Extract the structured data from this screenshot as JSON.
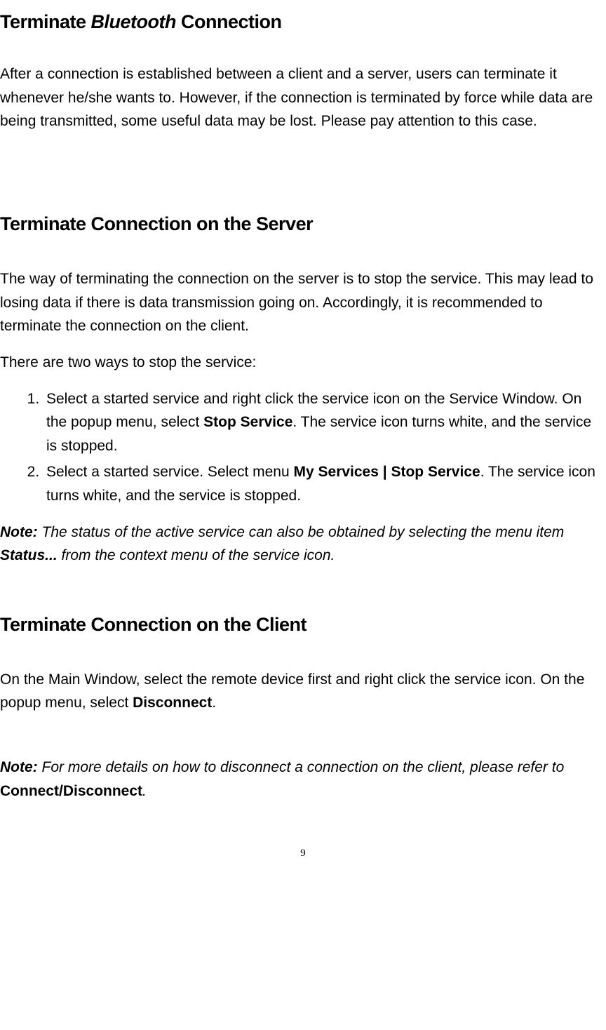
{
  "heading1": {
    "pre": "Terminate ",
    "em": "Bluetooth",
    "post": " Connection"
  },
  "para1": "After a connection is established between a client and a server, users can terminate it whenever he/she wants to. However, if the connection is terminated by force while data are being transmitted, some useful data may be lost. Please pay attention to this case.",
  "heading2": "Terminate Connection on the Server",
  "para2": "The way of terminating the connection on the server is to stop the service. This may lead to losing data if there is data transmission going on. Accordingly, it is recommended to terminate the connection on the client.",
  "para3": "There are two ways to stop the service:",
  "list": {
    "item1": {
      "t1": "Select a started service and right click the service icon on the Service Window.   On the popup menu, select ",
      "b1": "Stop Service",
      "t2": ". The service icon turns white, and the service is stopped."
    },
    "item2": {
      "t1": "Select a started service. Select menu ",
      "b1": "My Services | Stop Service",
      "t2": ". The service icon turns white, and the service is stopped."
    }
  },
  "note1": {
    "label": "Note:",
    "t1": " The status of the active service can also be obtained by selecting the menu item ",
    "b1": "Status...",
    "t2": " from the context menu of the service icon."
  },
  "heading3": "Terminate Connection on the Client",
  "para4": {
    "t1": "On the Main Window, select the remote device first and right click the service icon. On the popup menu, select ",
    "b1": "Disconnect",
    "t2": "."
  },
  "note2": {
    "label": "Note:",
    "t1": " For more details on how to disconnect a connection on the client, please refer to ",
    "b1": "Connect/Disconnect",
    "t2": "."
  },
  "pageNumber": "9"
}
